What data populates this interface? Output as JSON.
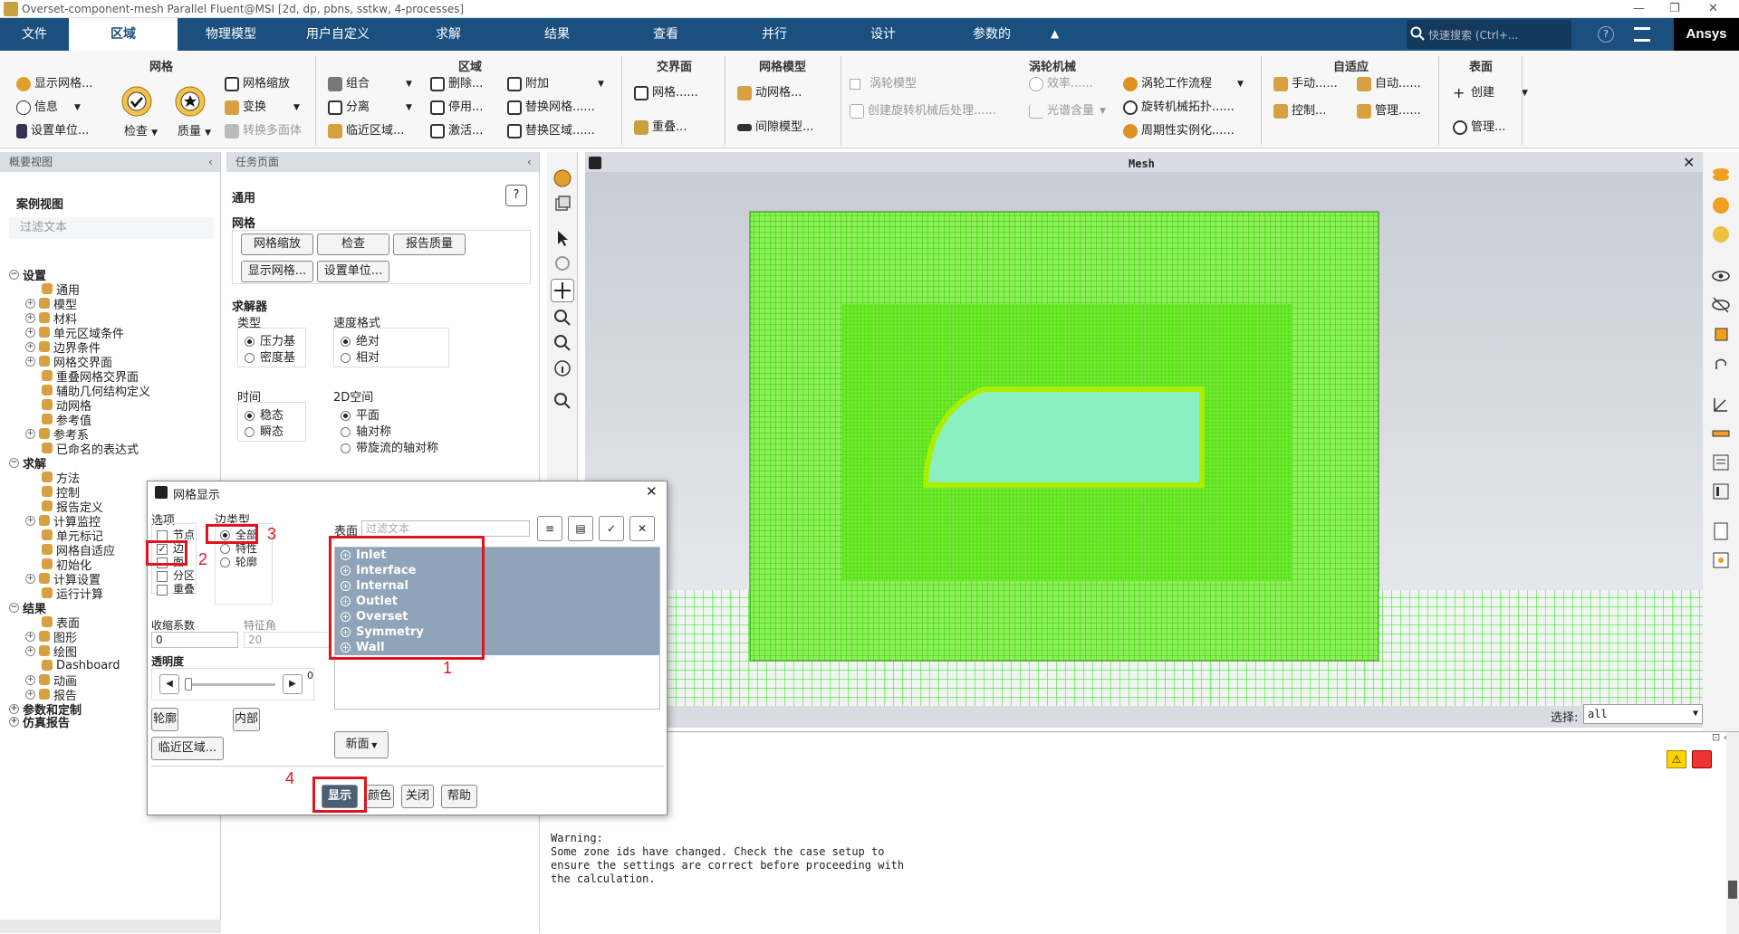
{
  "window": {
    "title": "Overset-component-mesh Parallel Fluent@MSI  [2d, dp, pbns, sstkw, 4-processes]",
    "controls": [
      "—",
      "❐",
      "✕"
    ]
  },
  "menubar": {
    "tabs": [
      "文件",
      "区域",
      "物理模型",
      "用户自定义",
      "求解",
      "结果",
      "查看",
      "并行",
      "设计",
      "参数的"
    ],
    "active": "区域",
    "search_placeholder": "快速搜索 (Ctrl+...",
    "brand": "Ansys",
    "brand_color": "#1b4f7d"
  },
  "ribbon": {
    "mesh": {
      "title": "网格",
      "display": "显示网格...",
      "info": "信息",
      "units": "设置单位...",
      "check": "检查",
      "quality": "质量",
      "scale": "网格缩放",
      "transform": "变换",
      "poly": "转换多面体"
    },
    "zones": {
      "title": "区域",
      "combine": "组合",
      "separate": "分离",
      "adjacency": "临近区域...",
      "delete": "删除...",
      "deactivate": "停用...",
      "activate": "激活...",
      "append": "附加",
      "replace_mesh": "替换网格......",
      "replace_zone": "替换区域......"
    },
    "interfaces": {
      "title": "交界面",
      "mesh": "网格......",
      "overset": "重叠..."
    },
    "mesh_models": {
      "title": "网格模型",
      "dynamic": "动网格...",
      "gap": "间隙模型..."
    },
    "turbo": {
      "title": "涡轮机械",
      "turbo_model": "涡轮模型",
      "create_post": "创建旋转机械后处理......",
      "efficiency": "效率......",
      "spectral": "光谱含量",
      "workflow": "涡轮工作流程",
      "topology": "旋转机械拓扑......",
      "periodic": "周期性实例化......"
    },
    "adapt": {
      "title": "自适应",
      "manual": "手动......",
      "auto": "自动......",
      "control": "控制...",
      "manage": "管理......"
    },
    "surface": {
      "title": "表面",
      "create": "创建",
      "manage": "管理..."
    }
  },
  "outline": {
    "header": "概要视图",
    "case_view": "案例视图",
    "filter_placeholder": "过滤文本",
    "items": [
      {
        "label": "设置",
        "level": 0,
        "bold": true,
        "exp": "−"
      },
      {
        "label": "通用",
        "level": 2,
        "exp": ""
      },
      {
        "label": "模型",
        "level": 1,
        "exp": "+"
      },
      {
        "label": "材料",
        "level": 1,
        "exp": "+"
      },
      {
        "label": "单元区域条件",
        "level": 1,
        "exp": "+"
      },
      {
        "label": "边界条件",
        "level": 1,
        "exp": "+"
      },
      {
        "label": "网格交界面",
        "level": 1,
        "exp": "+"
      },
      {
        "label": "重叠网格交界面",
        "level": 2,
        "exp": ""
      },
      {
        "label": "辅助几何结构定义",
        "level": 2,
        "exp": ""
      },
      {
        "label": "动网格",
        "level": 2,
        "exp": ""
      },
      {
        "label": "参考值",
        "level": 2,
        "exp": ""
      },
      {
        "label": "参考系",
        "level": 1,
        "exp": "+"
      },
      {
        "label": "已命名的表达式",
        "level": 2,
        "exp": ""
      },
      {
        "label": "求解",
        "level": 0,
        "bold": true,
        "exp": "−"
      },
      {
        "label": "方法",
        "level": 2,
        "exp": ""
      },
      {
        "label": "控制",
        "level": 2,
        "exp": ""
      },
      {
        "label": "报告定义",
        "level": 2,
        "exp": ""
      },
      {
        "label": "计算监控",
        "level": 1,
        "exp": "+"
      },
      {
        "label": "单元标记",
        "level": 2,
        "exp": ""
      },
      {
        "label": "网格自适应",
        "level": 2,
        "exp": ""
      },
      {
        "label": "初始化",
        "level": 2,
        "exp": ""
      },
      {
        "label": "计算设置",
        "level": 1,
        "exp": "+"
      },
      {
        "label": "运行计算",
        "level": 2,
        "exp": ""
      },
      {
        "label": "结果",
        "level": 0,
        "bold": true,
        "exp": "−"
      },
      {
        "label": "表面",
        "level": 2,
        "exp": ""
      },
      {
        "label": "图形",
        "level": 1,
        "exp": "+"
      },
      {
        "label": "绘图",
        "level": 1,
        "exp": "+"
      },
      {
        "label": "Dashboard",
        "level": 2,
        "exp": ""
      },
      {
        "label": "动画",
        "level": 1,
        "exp": "+"
      },
      {
        "label": "报告",
        "level": 1,
        "exp": "+"
      },
      {
        "label": "参数和定制",
        "level": 0,
        "bold": true,
        "exp": "+"
      },
      {
        "label": "仿真报告",
        "level": 0,
        "bold": true,
        "exp": "+"
      }
    ]
  },
  "taskpage": {
    "header": "任务页面",
    "general": "通用",
    "mesh_label": "网格",
    "btn_scale": "网格缩放",
    "btn_check": "检查",
    "btn_report": "报告质量",
    "btn_display": "显示网格...",
    "btn_units": "设置单位...",
    "solver_label": "求解器",
    "type_label": "类型",
    "type_options": [
      "压力基",
      "密度基"
    ],
    "velocity_label": "速度格式",
    "velocity_options": [
      "绝对",
      "相对"
    ],
    "time_label": "时间",
    "time_options": [
      "稳态",
      "瞬态"
    ],
    "space_label": "2D空间",
    "space_options": [
      "平面",
      "轴对称",
      "带旋流的轴对称"
    ]
  },
  "graphics": {
    "title": "Mesh",
    "selection_label": "选择:",
    "selection_value": "all",
    "mesh_color": "#55ee11"
  },
  "console": {
    "lines": [
      "ponent",
      "",
      "aces,",
      "",
      "",
      "",
      "Warning:",
      "Some zone ids have changed. Check the case setup to",
      "ensure the settings are correct before proceeding with",
      "the calculation."
    ]
  },
  "dialog": {
    "title": "网格显示",
    "options_label": "选项",
    "options": [
      {
        "label": "节点",
        "checked": false
      },
      {
        "label": "边",
        "checked": true
      },
      {
        "label": "面",
        "checked": false
      },
      {
        "label": "分区",
        "checked": false
      },
      {
        "label": "重叠",
        "checked": false
      }
    ],
    "edge_type_label": "边类型",
    "edge_types": [
      {
        "label": "全部",
        "selected": true
      },
      {
        "label": "特性",
        "selected": false
      },
      {
        "label": "轮廓",
        "selected": false
      }
    ],
    "surface_label": "表面",
    "surface_filter_placeholder": "过滤文本",
    "surfaces": [
      "Inlet",
      "Interface",
      "Internal",
      "Outlet",
      "Overset",
      "Symmetry",
      "Wall"
    ],
    "shrink_label": "收缩系数",
    "shrink_value": "0",
    "feature_label": "特征角",
    "feature_value": "20",
    "transparency_label": "透明度",
    "transparency_value": "0",
    "btn_outline": "轮廓",
    "btn_interior": "内部",
    "btn_adjacent": "临近区域...",
    "btn_new_surface": "新面",
    "btn_display": "显示",
    "btn_colors": "颜色",
    "btn_close": "关闭",
    "btn_help": "帮助",
    "annotations": [
      "1",
      "2",
      "3",
      "4"
    ],
    "annotation_color": "#e0141e"
  }
}
